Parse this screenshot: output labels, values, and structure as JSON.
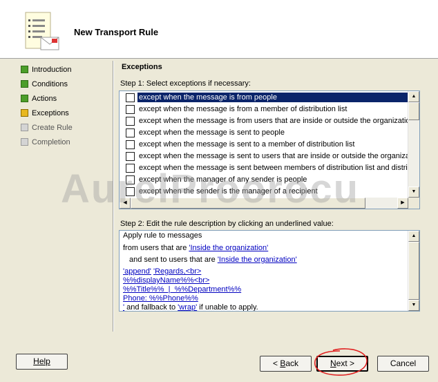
{
  "window": {
    "title": "New Transport Rule"
  },
  "nav": {
    "items": [
      {
        "label": "Introduction",
        "state": "complete",
        "color": "#4c9e2a"
      },
      {
        "label": "Conditions",
        "state": "complete",
        "color": "#4c9e2a"
      },
      {
        "label": "Actions",
        "state": "complete",
        "color": "#4c9e2a"
      },
      {
        "label": "Exceptions",
        "state": "current",
        "color": "#e8b820"
      },
      {
        "label": "Create Rule",
        "state": "pending",
        "color": "#d4d4d4"
      },
      {
        "label": "Completion",
        "state": "pending",
        "color": "#d4d4d4"
      }
    ]
  },
  "main": {
    "section_title": "Exceptions",
    "step1_label": "Step 1: Select exceptions if necessary:",
    "exceptions": [
      {
        "label": "except when the message is from people",
        "checked": false,
        "selected": true
      },
      {
        "label": "except when the message is from a member of distribution list",
        "checked": false,
        "selected": false
      },
      {
        "label": "except when the message is from users that are inside or outside the organization",
        "checked": false,
        "selected": false
      },
      {
        "label": "except when the message is sent to people",
        "checked": false,
        "selected": false
      },
      {
        "label": "except when the message is sent to a member of distribution list",
        "checked": false,
        "selected": false
      },
      {
        "label": "except when the message is sent to users that are inside or outside the organization",
        "checked": false,
        "selected": false
      },
      {
        "label": "except when the message is sent between members of distribution list and distributio",
        "checked": false,
        "selected": false
      },
      {
        "label": "except when the manager of any sender is people",
        "checked": false,
        "selected": false
      },
      {
        "label": "except when the sender is the manager of a recipient",
        "checked": false,
        "selected": false
      }
    ],
    "step2_label": "Step 2: Edit the rule description by clicking an underlined value:",
    "description": {
      "line1": "Apply rule to messages",
      "line2_prefix": "from users that are ",
      "line2_link": "'Inside the organization'",
      "line3_prefix": "and sent to users that are ",
      "line3_link": "'Inside the organization'",
      "line4_link1": "'append'",
      "line4_link2": "'Regards,<br>",
      "line5_link": "%%displayName%%<br>",
      "line6_link": "%%Title%%  |  %%Department%%",
      "line7_link": "Phone: %%Phone%%",
      "line8_link1": "'",
      "line8_mid": " and fallback to ",
      "line8_link2": "'wrap'",
      "line8_suffix": " if unable to apply."
    }
  },
  "watermark": "AurelProorocu",
  "footer": {
    "help": "Help",
    "back_prefix": "< ",
    "back_key": "B",
    "back_rest": "ack",
    "next_key": "N",
    "next_rest": "ext >",
    "cancel": "Cancel"
  },
  "colors": {
    "selection": "#0a246a",
    "link": "#0000c0",
    "annotation_circle": "#e02020"
  }
}
